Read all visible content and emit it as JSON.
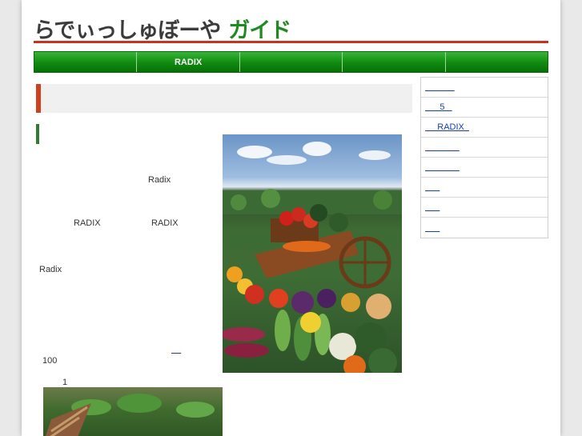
{
  "header": {
    "logo_main": "らでぃっしゅぼーや",
    "logo_accent": "ガイド"
  },
  "nav": {
    "items": [
      "",
      "RADIX",
      "",
      "",
      ""
    ]
  },
  "content": {
    "text_radix_1": "Radix",
    "text_radix_2": "RADIX",
    "text_radix_3": "RADIX",
    "text_radix_4": "Radix",
    "link_more": "    ",
    "text_100": "100",
    "text_1": "1"
  },
  "sidebar": {
    "items": [
      "            ",
      "      5   ",
      "     RADIX  ",
      "              ",
      "              ",
      "      ",
      "      ",
      "      "
    ]
  },
  "colors": {
    "accent_green": "#1f8a1f",
    "accent_red": "#c8321e",
    "link_blue": "#1a3fa6"
  }
}
